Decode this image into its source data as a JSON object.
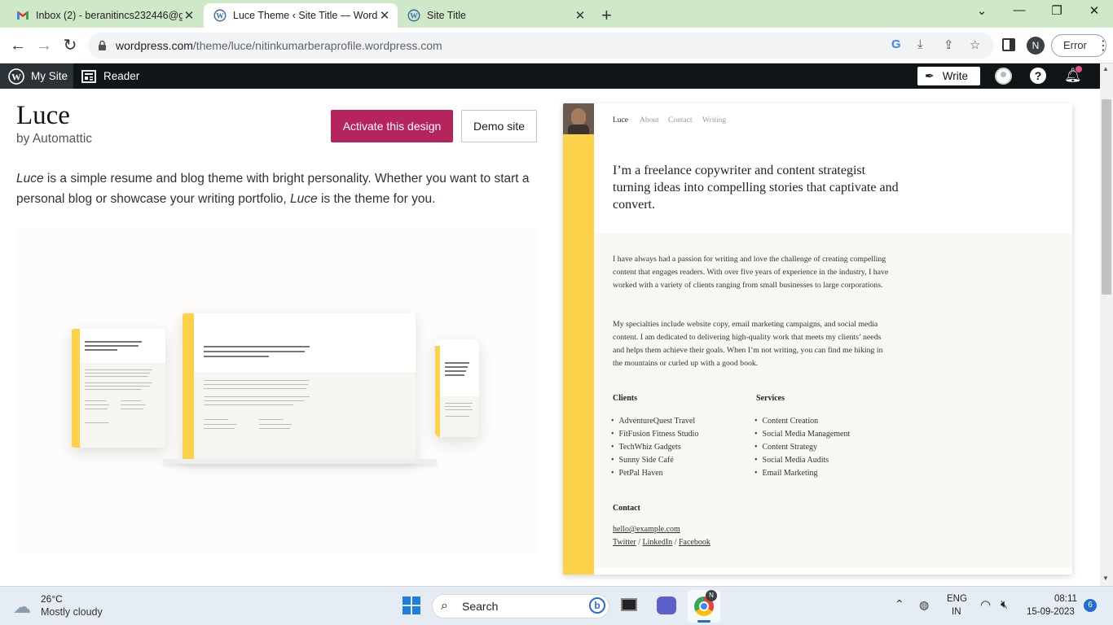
{
  "browser": {
    "tabs": [
      {
        "title": "Inbox (2) - beranitincs232446@g",
        "icon": "gmail-icon",
        "active": false
      },
      {
        "title": "Luce Theme ‹ Site Title — WordP",
        "icon": "wordpress-icon",
        "active": true
      },
      {
        "title": "Site Title",
        "icon": "wordpress-icon",
        "active": false
      }
    ],
    "new_tab": "+",
    "url_domain": "wordpress.com",
    "url_path": "/theme/luce/nitinkumarberaprofile.wordpress.com",
    "profile_initial": "N",
    "error_label": "Error"
  },
  "admin_bar": {
    "my_site": "My Site",
    "reader": "Reader",
    "write": "Write"
  },
  "theme": {
    "name": "Luce",
    "byline": "by Automattic",
    "activate_label": "Activate this design",
    "demo_label": "Demo site",
    "description_parts": [
      "Luce",
      " is a simple resume and blog theme with bright personality. Whether you want to start a personal blog or showcase your writing portfolio, ",
      "Luce",
      " is the theme for you."
    ]
  },
  "preview": {
    "nav": [
      "Luce",
      "About",
      "Contact",
      "Writing"
    ],
    "hero": "I’m a freelance copywriter and content strategist turning ideas into compelling stories that captivate and convert.",
    "para1": "I have always had a passion for writing and love the challenge of creating compelling content that engages readers. With over five years of experience in the industry, I have worked with a variety of clients ranging from small businesses to large corporations.",
    "para2": "My specialties include website copy, email marketing campaigns, and social media content. I am dedicated to delivering high-quality work that meets my clients’ needs and helps them achieve their goals. When I’m not writing, you can find me hiking in the mountains or curled up with a good book.",
    "clients_heading": "Clients",
    "clients": [
      "AdventureQuest Travel",
      "FitFusion Fitness Studio",
      "TechWhiz Gadgets",
      "Sunny Side Café",
      "PetPal Haven"
    ],
    "services_heading": "Services",
    "services": [
      "Content Creation",
      "Social Media Management",
      "Content Strategy",
      "Social Media Audits",
      "Email Marketing"
    ],
    "contact_heading": "Contact",
    "email": "hello@example.com",
    "social": [
      "Twitter",
      "LinkedIn",
      "Facebook"
    ],
    "social_sep": " / "
  },
  "taskbar": {
    "temperature": "26°C",
    "weather": "Mostly cloudy",
    "search_placeholder": "Search",
    "language": "ENG",
    "region": "IN",
    "time": "08:11",
    "date": "15-09-2023",
    "notification_count": "6"
  },
  "colors": {
    "accent": "#b5245c",
    "theme_yellow": "#fdd14a",
    "tab_bar": "#cfe8c8",
    "admin_bar": "#101517"
  }
}
